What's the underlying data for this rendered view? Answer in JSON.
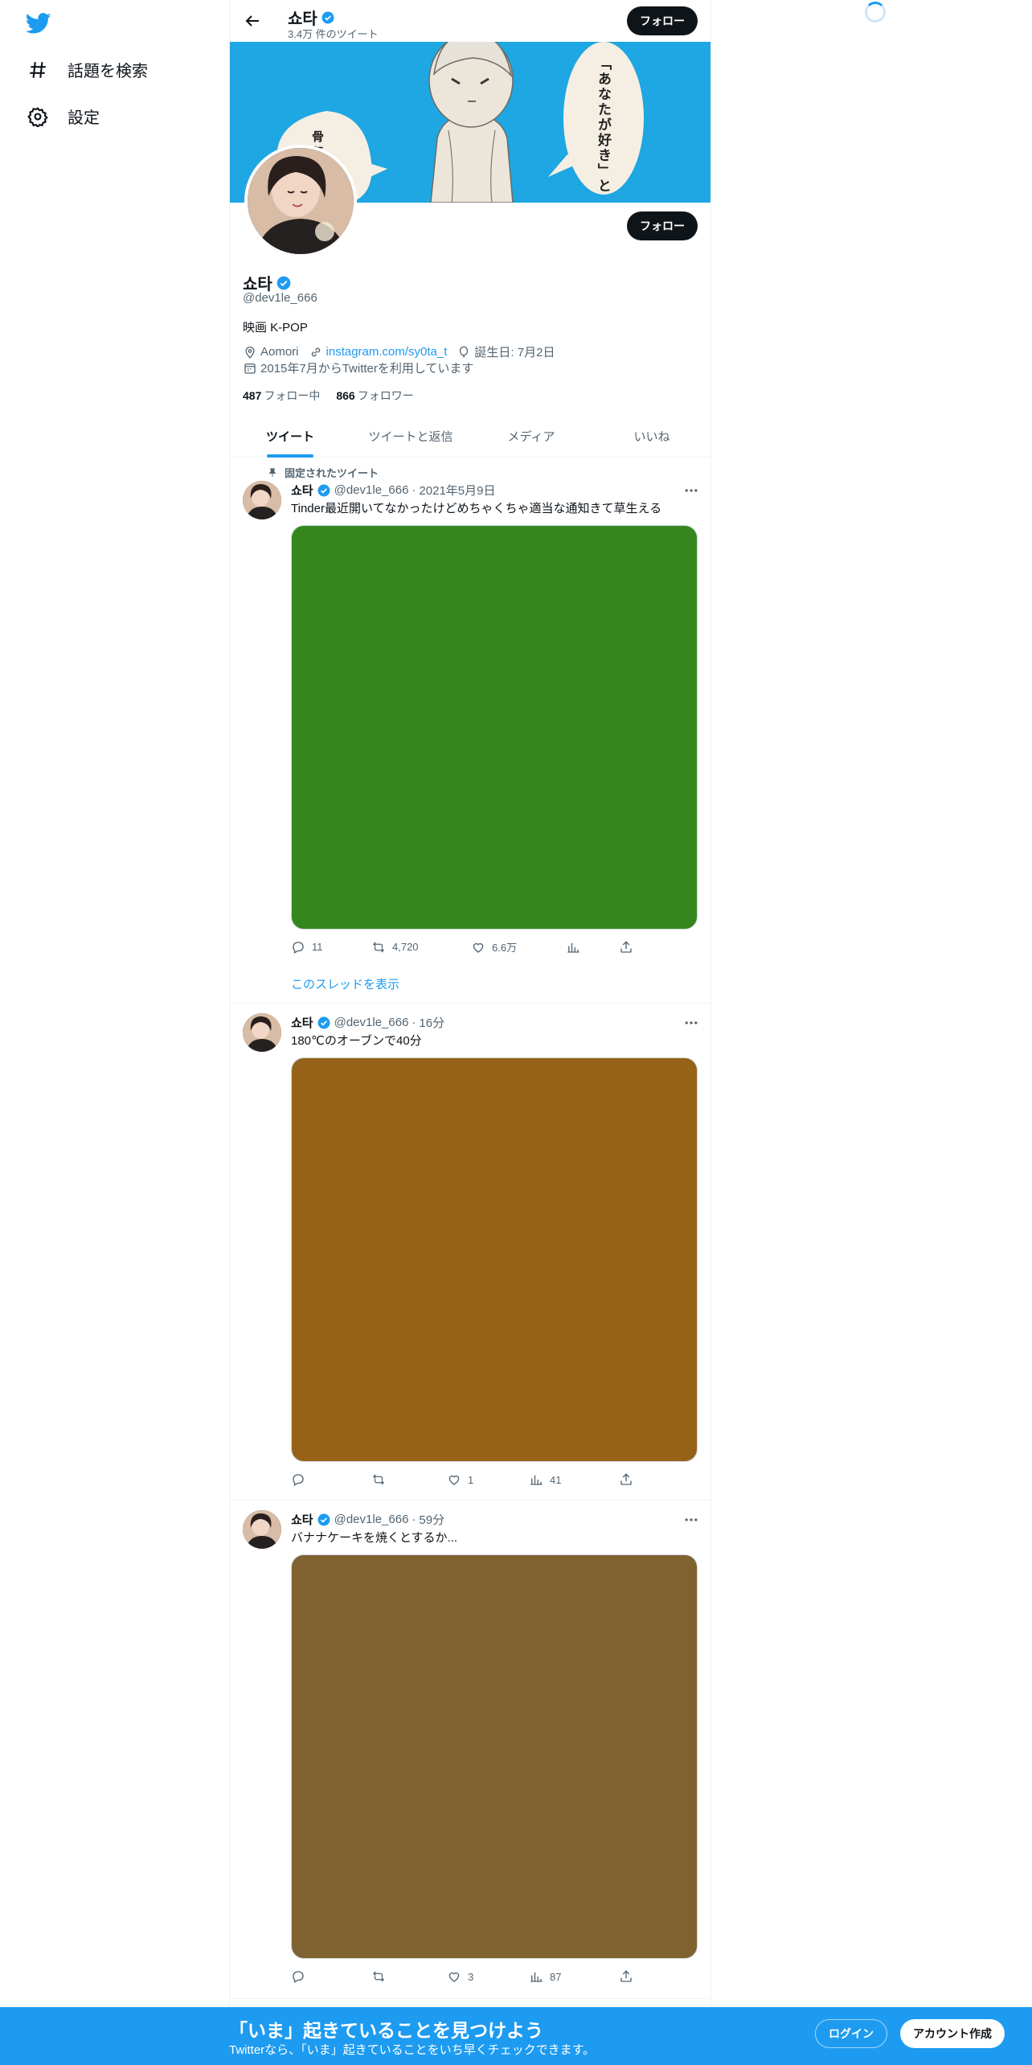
{
  "brand_color": "#1d9bf0",
  "nav": {
    "logo_icon": "twitter-bird-icon",
    "items": [
      {
        "label": "話題を検索",
        "icon": "hashtag-icon"
      },
      {
        "label": "設定",
        "icon": "gear-icon"
      }
    ]
  },
  "header": {
    "title": "쇼타",
    "tweet_count": "3.4万 件のツイート",
    "follow_label": "フォロー"
  },
  "banner": {
    "color": "#1ea7e2",
    "bubble_right": "「あなたが好き」と",
    "bubble_left": "骨 伝"
  },
  "profile": {
    "name": "쇼타",
    "handle": "@dev1le_666",
    "bio": "映画 K-POP",
    "location": "Aomori",
    "website": "instagram.com/sy0ta_t",
    "birthday": "誕生日: 7月2日",
    "joined": "2015年7月からTwitterを利用しています",
    "following_count": "487",
    "following_label": "フォロー中",
    "followers_count": "866",
    "followers_label": "フォロワー",
    "follow_label": "フォロー"
  },
  "tabs": [
    {
      "label": "ツイート",
      "active": true
    },
    {
      "label": "ツイートと返信",
      "active": false
    },
    {
      "label": "メディア",
      "active": false
    },
    {
      "label": "いいね",
      "active": false
    }
  ],
  "tweets": [
    {
      "pinned_label": "固定されたツイート",
      "name": "쇼타",
      "handle": "@dev1le_666",
      "time": "2021年5月9日",
      "text": "Tinder最近開いてなかったけどめちゃくちゃ適当な通知きて草生える",
      "media_color": "#36861e",
      "replies": "11",
      "retweets": "4,720",
      "likes": "6.6万",
      "views": "",
      "thread_label": "このスレッドを表示"
    },
    {
      "name": "쇼타",
      "handle": "@dev1le_666",
      "time": "16分",
      "text": "180℃のオーブンで40分",
      "media_color": "#956218",
      "replies": "",
      "retweets": "",
      "likes": "1",
      "views": "41"
    },
    {
      "name": "쇼타",
      "handle": "@dev1le_666",
      "time": "59分",
      "text": "バナナケーキを焼くとするか...",
      "media_color": "#806230",
      "replies": "",
      "retweets": "",
      "likes": "3",
      "views": "87"
    }
  ],
  "bottom_bar": {
    "title": "「いま」起きていることを見つけよう",
    "subtitle": "Twitterなら、「いま」起きていることをいち早くチェックできます。",
    "login_label": "ログイン",
    "signup_label": "アカウント作成"
  }
}
